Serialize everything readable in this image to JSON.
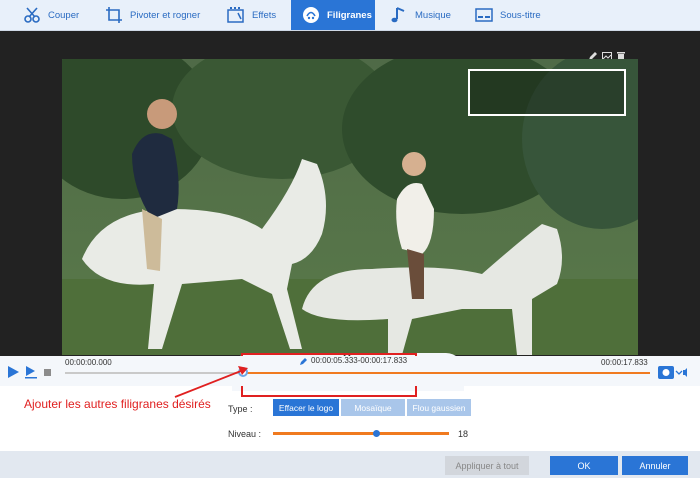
{
  "toolbar": {
    "tabs": [
      {
        "label": "Couper",
        "icon": "scissors-icon"
      },
      {
        "label": "Pivoter et rogner",
        "icon": "crop-rotate-icon"
      },
      {
        "label": "Effets",
        "icon": "effects-icon"
      },
      {
        "label": "Filigranes",
        "icon": "watermark-icon",
        "active": true
      },
      {
        "label": "Musique",
        "icon": "music-note-icon"
      },
      {
        "label": "Sous-titre",
        "icon": "subtitle-icon"
      }
    ]
  },
  "preview": {
    "watermark_tools": [
      "add-text-watermark-icon",
      "add-image-watermark-icon",
      "add-video-watermark-icon",
      "add-shape-watermark-icon",
      "eraser-icon"
    ],
    "segment_range": "00:00:05.333-00:00:17.833"
  },
  "timeline": {
    "start_time": "00:00:00.000",
    "end_time": "00:00:17.833"
  },
  "annotation": "Ajouter les autres filigranes désirés",
  "settings": {
    "type_label": "Type :",
    "type_options": [
      "Effacer le logo",
      "Mosaïque",
      "Flou gaussien"
    ],
    "level_label": "Niveau :",
    "level_value": "18"
  },
  "footer": {
    "apply_all": "Appliquer à tout",
    "ok": "OK",
    "cancel": "Annuler"
  },
  "colors": {
    "accent": "#2a75d6",
    "orange": "#f07a1f",
    "annotation": "#e02020"
  }
}
